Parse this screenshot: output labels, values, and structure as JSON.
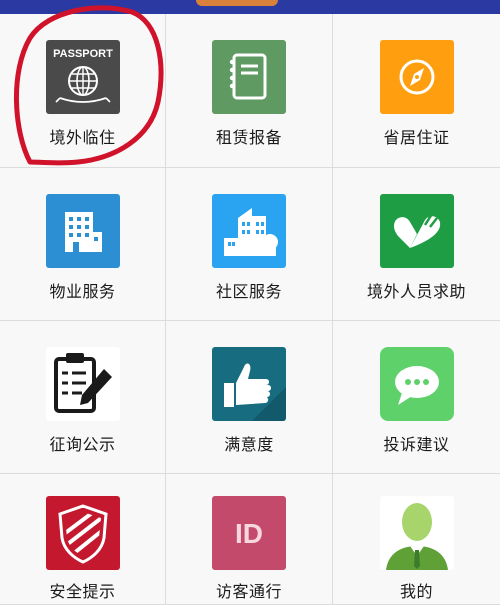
{
  "grid": {
    "items": [
      {
        "label": "境外临住",
        "icon": "passport-icon",
        "color": "#4a4a4a"
      },
      {
        "label": "租赁报备",
        "icon": "notebook-icon",
        "color": "#5e9a62"
      },
      {
        "label": "省居住证",
        "icon": "compass-icon",
        "color": "#ff9f0f"
      },
      {
        "label": "物业服务",
        "icon": "building-icon",
        "color": "#2d8fd3"
      },
      {
        "label": "社区服务",
        "icon": "community-icon",
        "color": "#2aa4f0"
      },
      {
        "label": "境外人员求助",
        "icon": "helping-hand-heart-icon",
        "color": "#1f9d44"
      },
      {
        "label": "征询公示",
        "icon": "clipboard-pencil-icon",
        "color": "#ffffff"
      },
      {
        "label": "满意度",
        "icon": "thumbs-up-icon",
        "color": "#176c80"
      },
      {
        "label": "投诉建议",
        "icon": "chat-bubble-icon",
        "color": "#5fd16b"
      },
      {
        "label": "安全提示",
        "icon": "shield-icon",
        "color": "#c3182e"
      },
      {
        "label": "访客通行",
        "icon": "id-card-icon",
        "color": "#c34a6a"
      },
      {
        "label": "我的",
        "icon": "user-avatar-icon",
        "color": "#a7d46b"
      }
    ],
    "passport_text": "PASSPORT",
    "id_text": "ID"
  },
  "annotation": {
    "color": "#d0122a"
  }
}
